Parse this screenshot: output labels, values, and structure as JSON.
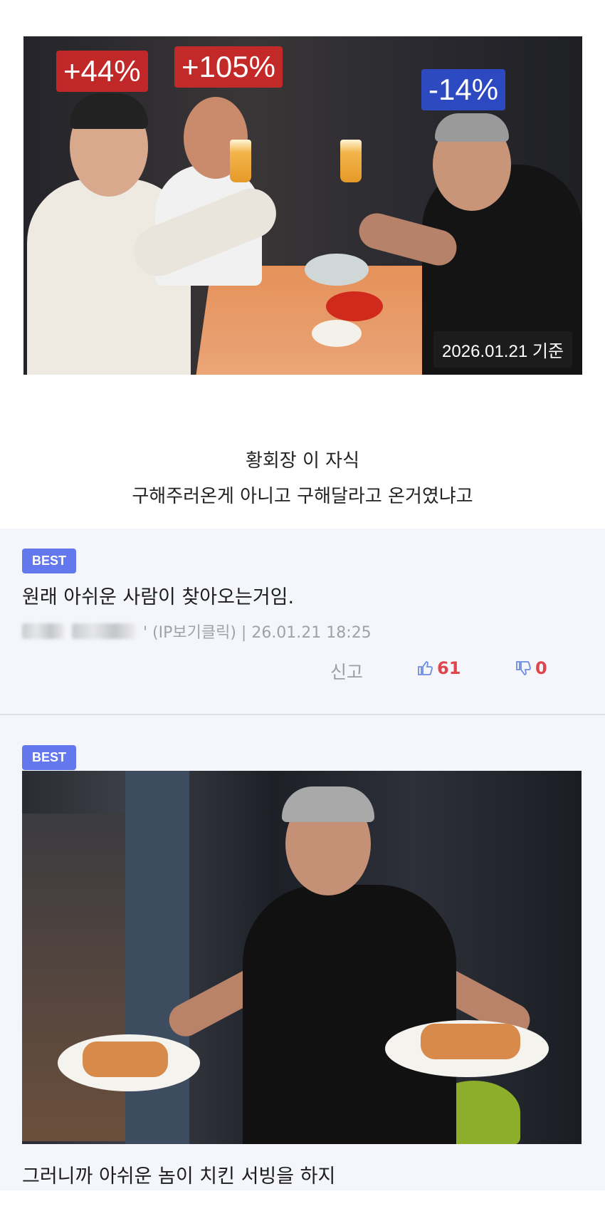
{
  "post": {
    "photo": {
      "badges": [
        {
          "text": "+44%",
          "tone": "up"
        },
        {
          "text": "+105%",
          "tone": "up"
        },
        {
          "text": "-14%",
          "tone": "down"
        }
      ],
      "date_stamp": "2026.01.21 기준"
    },
    "caption": {
      "line1": "황회장 이 자식",
      "line2": "구해주러온게 아니고 구해달라고 온거였냐고"
    }
  },
  "comments": [
    {
      "badge": "BEST",
      "text": "원래 아쉬운 사람이 찾아오는거임.",
      "meta": "' (IP보기클릭) | 26.01.21 18:25",
      "report_label": "신고",
      "likes": "61",
      "dislikes": "0"
    },
    {
      "badge": "BEST",
      "text": "그러니까 아쉬운 놈이 치킨 서빙을 하지"
    }
  ],
  "colors": {
    "best_badge": "#6478ee",
    "up_badge": "#d62828",
    "down_badge": "#2d4ed6",
    "vote_count": "#e0454d",
    "comment_bg": "#f4f6fb"
  },
  "icons": {
    "like": "thumbs-up-icon",
    "dislike": "thumbs-down-icon"
  }
}
